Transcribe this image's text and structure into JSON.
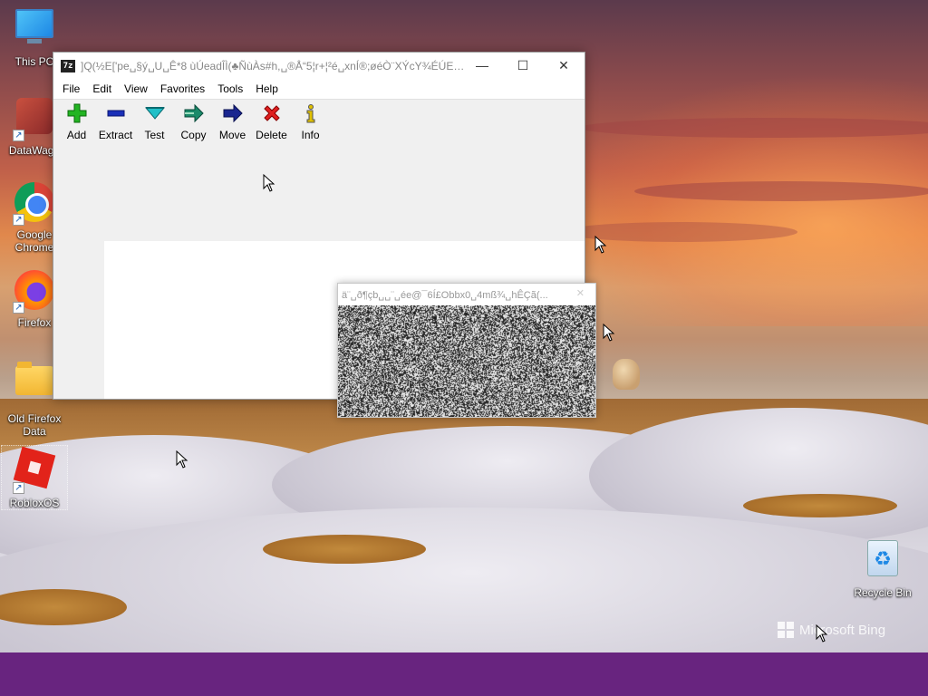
{
  "desktop": {
    "icons": [
      {
        "label": "This PC"
      },
      {
        "label": "DataWago"
      },
      {
        "label": "Google Chrome"
      },
      {
        "label": "Firefox"
      },
      {
        "label": "Old Firefox Data"
      },
      {
        "label": "RobloxOS"
      },
      {
        "label": "Recycle Bin"
      }
    ],
    "watermark": "Microsoft Bing"
  },
  "zip_window": {
    "title": "]Q(½E['pe␣§ý␣U␣Ê*8 ùÚeadÎÌ(♣ÑùÀs#h,␣®Å“5¦r+¦²é␣xnÍ®;øéÒ¨XÝcY¾ÉÚEu...",
    "app_icon_text": "7z",
    "controls": {
      "minimize": "—",
      "maximize": "☐",
      "close": "✕"
    },
    "menu": [
      "File",
      "Edit",
      "View",
      "Favorites",
      "Tools",
      "Help"
    ],
    "toolbar": [
      {
        "label": "Add",
        "icon": "plus-icon",
        "color": "#22b422"
      },
      {
        "label": "Extract",
        "icon": "minus-icon",
        "color": "#1a2fb8"
      },
      {
        "label": "Test",
        "icon": "check-down-icon",
        "color": "#20c0c8"
      },
      {
        "label": "Copy",
        "icon": "double-arrow-icon",
        "color": "#1a8a6a"
      },
      {
        "label": "Move",
        "icon": "arrow-right-icon",
        "color": "#1a2690"
      },
      {
        "label": "Delete",
        "icon": "x-icon",
        "color": "#e02020"
      },
      {
        "label": "Info",
        "icon": "info-icon",
        "color": "#e0c000"
      }
    ]
  },
  "noise_window": {
    "title": "ä¨␣ð¶çb␣␣¨␣ée@¯6Í£Obbx0␣4mß¾␣hÊÇã(...",
    "close": "✕"
  },
  "colors": {
    "taskbar": "#68247f"
  }
}
